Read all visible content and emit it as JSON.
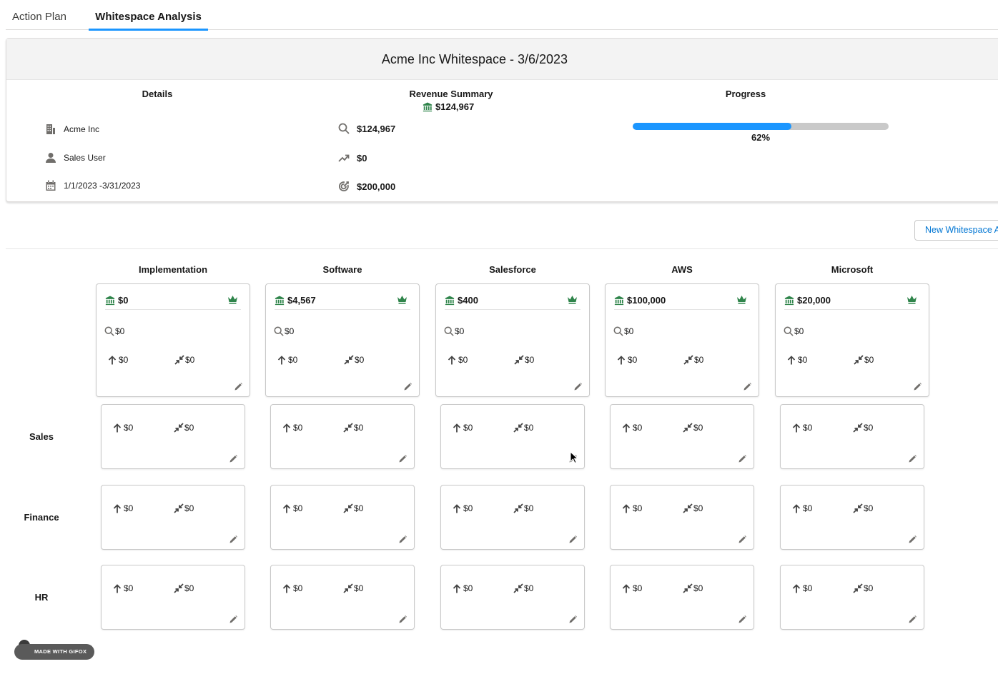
{
  "tabs": [
    {
      "label": "Action Plan",
      "active": false
    },
    {
      "label": "Whitespace Analysis",
      "active": true
    }
  ],
  "summary": {
    "title": "Acme Inc Whitespace - 3/6/2023",
    "details": {
      "heading": "Details",
      "account": "Acme Inc",
      "owner": "Sales User",
      "date_range": "1/1/2023 -3/31/2023"
    },
    "revenue": {
      "heading": "Revenue Summary",
      "total": "$124,967",
      "pipeline": "$124,967",
      "trend": "$0",
      "target": "$200,000"
    },
    "progress": {
      "heading": "Progress",
      "value": 62,
      "label": "62%",
      "color": "#1b96ff"
    }
  },
  "new_button_label": "New Whitespace Analysis",
  "products": [
    {
      "name": "Implementation",
      "revenue": "$0",
      "search": "$0",
      "up": "$0",
      "compare": "$0"
    },
    {
      "name": "Software",
      "revenue": "$4,567",
      "search": "$0",
      "up": "$0",
      "compare": "$0"
    },
    {
      "name": "Salesforce",
      "revenue": "$400",
      "search": "$0",
      "up": "$0",
      "compare": "$0"
    },
    {
      "name": "AWS",
      "revenue": "$100,000",
      "search": "$0",
      "up": "$0",
      "compare": "$0"
    },
    {
      "name": "Microsoft",
      "revenue": "$20,000",
      "search": "$0",
      "up": "$0",
      "compare": "$0"
    }
  ],
  "departments": [
    {
      "name": "Sales",
      "cells": [
        {
          "up": "$0",
          "compare": "$0"
        },
        {
          "up": "$0",
          "compare": "$0"
        },
        {
          "up": "$0",
          "compare": "$0"
        },
        {
          "up": "$0",
          "compare": "$0"
        },
        {
          "up": "$0",
          "compare": "$0"
        }
      ]
    },
    {
      "name": "Finance",
      "cells": [
        {
          "up": "$0",
          "compare": "$0"
        },
        {
          "up": "$0",
          "compare": "$0"
        },
        {
          "up": "$0",
          "compare": "$0"
        },
        {
          "up": "$0",
          "compare": "$0"
        },
        {
          "up": "$0",
          "compare": "$0"
        }
      ]
    },
    {
      "name": "HR",
      "cells": [
        {
          "up": "$0",
          "compare": "$0"
        },
        {
          "up": "$0",
          "compare": "$0"
        },
        {
          "up": "$0",
          "compare": "$0"
        },
        {
          "up": "$0",
          "compare": "$0"
        },
        {
          "up": "$0",
          "compare": "$0"
        }
      ]
    }
  ],
  "watermark": "MADE WITH GIFOX",
  "colors": {
    "accent": "#1b96ff",
    "bank_green": "#2e844a",
    "link": "#0176d3"
  }
}
